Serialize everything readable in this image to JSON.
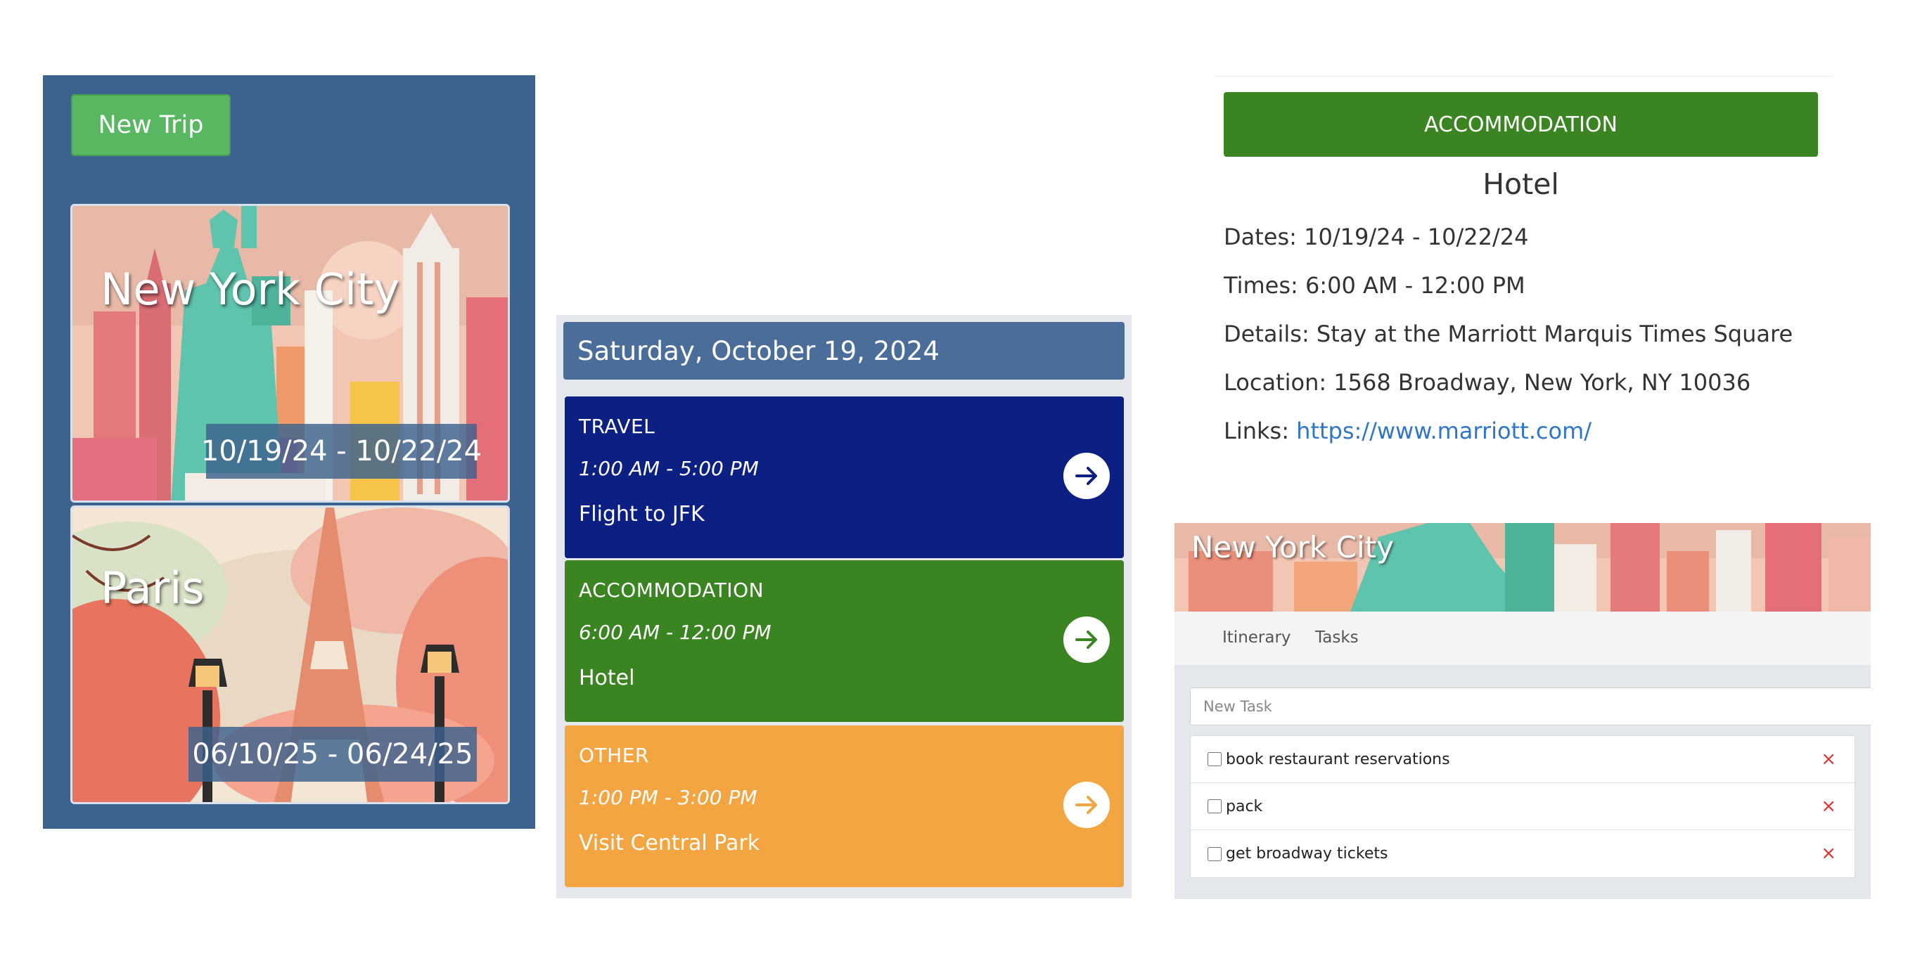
{
  "trip_list": {
    "new_trip_label": "New Trip",
    "trips": [
      {
        "name": "New York City",
        "dates": "10/19/24 - 10/22/24"
      },
      {
        "name": "Paris",
        "dates": "06/10/25 - 06/24/25"
      }
    ]
  },
  "itinerary": {
    "date_header": "Saturday, October 19, 2024",
    "events": [
      {
        "category": "TRAVEL",
        "time": "1:00 AM - 5:00 PM",
        "title": "Flight to JFK",
        "color": "#0c1f82"
      },
      {
        "category": "ACCOMMODATION",
        "time": "6:00 AM - 12:00 PM",
        "title": "Hotel",
        "color": "#3a8421"
      },
      {
        "category": "OTHER",
        "time": "1:00 PM - 3:00 PM",
        "title": "Visit Central Park",
        "color": "#f2a541"
      }
    ]
  },
  "event_detail": {
    "category_label": "ACCOMMODATION",
    "title": "Hotel",
    "dates_label": "Dates:",
    "dates": "10/19/24 - 10/22/24",
    "times_label": "Times:",
    "times": "6:00 AM - 12:00 PM",
    "details_label": "Details:",
    "details": "Stay at the Marriott Marquis Times Square",
    "location_label": "Location:",
    "location": "1568 Broadway, New York, NY 10036",
    "links_label": "Links:",
    "link": "https://www.marriott.com/"
  },
  "trip_tasks": {
    "trip_title": "New York City",
    "tabs": [
      "Itinerary",
      "Tasks"
    ],
    "new_task_placeholder": "New Task",
    "delete_glyph": "×",
    "tasks": [
      {
        "text": "book restaurant reservations",
        "checked": false
      },
      {
        "text": "pack",
        "checked": false
      },
      {
        "text": "get broadway tickets",
        "checked": false
      }
    ]
  },
  "colors": {
    "panel_blue": "#3c628e",
    "new_trip_green": "#58b760",
    "travel_navy": "#0c1f82",
    "accommodation_green": "#3a8421",
    "other_orange": "#f2a541",
    "link_blue": "#2f76c8",
    "delete_red": "#dd3333"
  },
  "icons": [
    "arrow-right-icon",
    "close-icon",
    "statue-of-liberty-illustration",
    "eiffel-tower-illustration"
  ]
}
